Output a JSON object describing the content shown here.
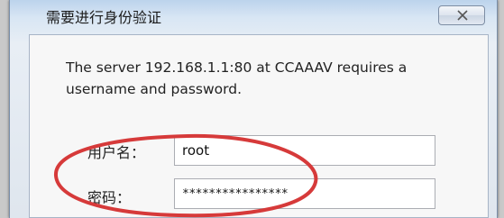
{
  "dialog": {
    "title": "需要进行身份验证",
    "message": "The server 192.168.1.1:80 at CCAAAV requires a username and password.",
    "username_label": "用户名：",
    "username_value": "root",
    "password_label": "密码：",
    "password_value": "****************"
  },
  "colors": {
    "annotation": "#d63a3a",
    "titlebar": "#bcd3ec"
  },
  "icons": {
    "close": "close-x-icon"
  }
}
